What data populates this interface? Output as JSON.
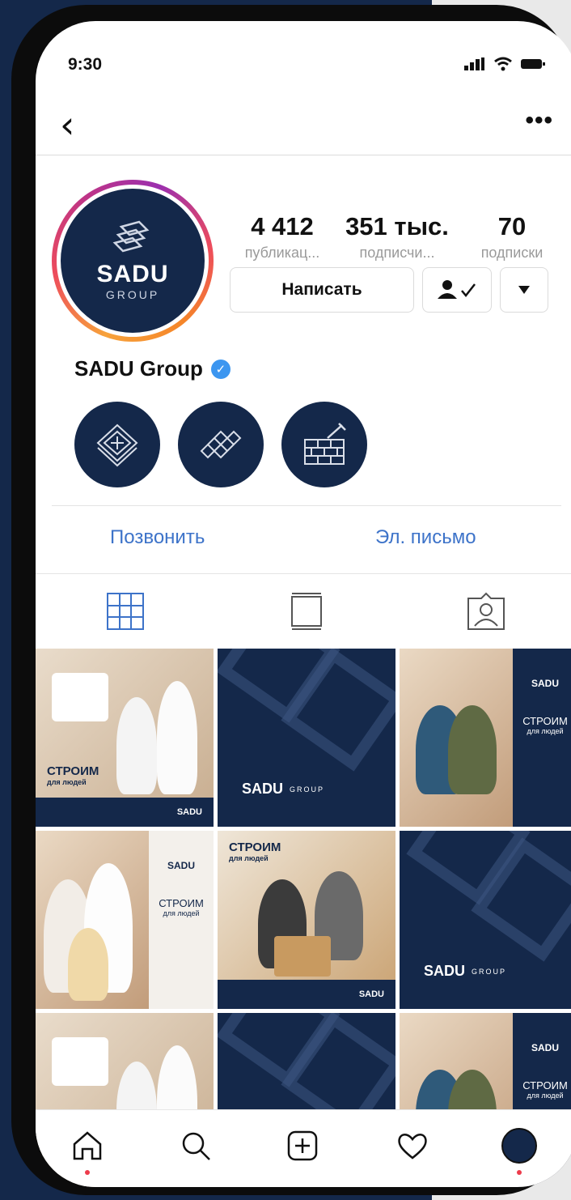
{
  "status_bar": {
    "time": "9:30"
  },
  "profile": {
    "avatar": {
      "brand": "SADU",
      "group": "GROUP"
    },
    "name": "SADU Group",
    "stats": [
      {
        "value": "4 412",
        "label": "публикац..."
      },
      {
        "value": "351 тыс.",
        "label": "подписчи..."
      },
      {
        "value": "70",
        "label": "подписки"
      }
    ],
    "message_button": "Написать"
  },
  "contacts": {
    "call": "Позвонить",
    "email": "Эл. письмо"
  },
  "posts": {
    "slogan": "СТРОИМ",
    "slogan_sub": "для людей",
    "brand": "SADU",
    "brand_sub": "GROUP"
  },
  "colors": {
    "navy": "#14284a",
    "link": "#3d73c9",
    "accent_red": "#ed3b4b"
  },
  "icons": [
    "back-icon",
    "more-icon",
    "follow-check-icon",
    "dropdown-icon",
    "grid-icon",
    "reels-icon",
    "tagged-icon",
    "home-icon",
    "search-icon",
    "add-icon",
    "heart-icon",
    "profile-avatar-icon"
  ]
}
